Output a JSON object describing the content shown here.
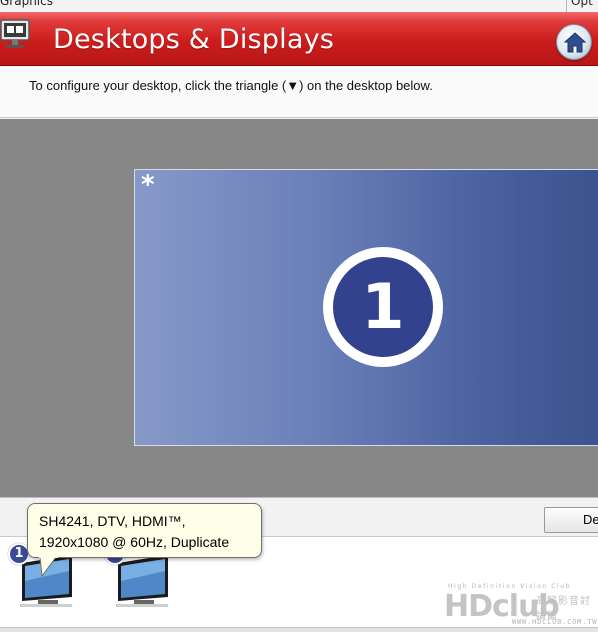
{
  "menubar": {
    "left_label": "Graphics",
    "right_label": "Opt"
  },
  "header": {
    "title": "Desktops & Displays",
    "icon": "monitor-app-icon",
    "home_icon": "home-icon"
  },
  "instruction": "To configure your desktop, click the triangle (▼) on the desktop below.",
  "desktop": {
    "marker": "*",
    "number": "1"
  },
  "bottom": {
    "detect_label": "De"
  },
  "displays": [
    {
      "badge": "1",
      "icon": "monitor-icon"
    },
    {
      "badge": "2",
      "icon": "monitor-icon"
    }
  ],
  "tooltip": {
    "line1": "SH4241, DTV, HDMI™,",
    "line2": "1920x1080 @ 60Hz, Duplicate"
  },
  "watermark": {
    "tagline": "High Definition Vision Club",
    "brand": "HDclub",
    "chinese": "高解影音討論區",
    "url": "WWW.HDCLUB.COM.TW"
  },
  "colors": {
    "header_red": "#cc1d1d",
    "desktop_blue": "#4b61a0",
    "badge_blue": "#33428f",
    "tooltip_bg": "#ffffe9"
  }
}
